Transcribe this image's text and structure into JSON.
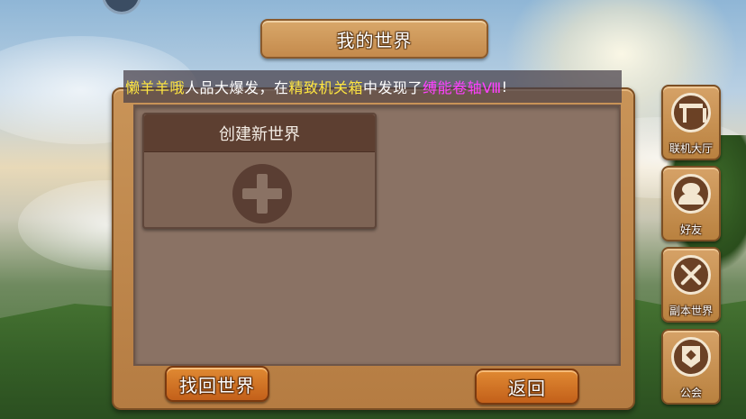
{
  "header": {
    "title": "我的世界"
  },
  "announcement": {
    "player": "懒羊羊哦",
    "text1": "人品大爆发，在",
    "source": "精致机关箱",
    "text2": "中发现了",
    "item": "缚能卷轴Ⅷ",
    "text3": "!"
  },
  "worlds": {
    "create_label": "创建新世界"
  },
  "footer": {
    "recover_label": "找回世界",
    "back_label": "返回"
  },
  "side_nav": {
    "items": [
      {
        "label": "联机大厅",
        "icon": "lobby-icon"
      },
      {
        "label": "好友",
        "icon": "friends-icon"
      },
      {
        "label": "副本世界",
        "icon": "swords-icon"
      },
      {
        "label": "公会",
        "icon": "guild-icon"
      }
    ]
  },
  "colors": {
    "announcement_player": "#ffe640",
    "announcement_item": "#ff40ff",
    "button_orange": "#d8782a",
    "wood": "#c48a4c"
  }
}
